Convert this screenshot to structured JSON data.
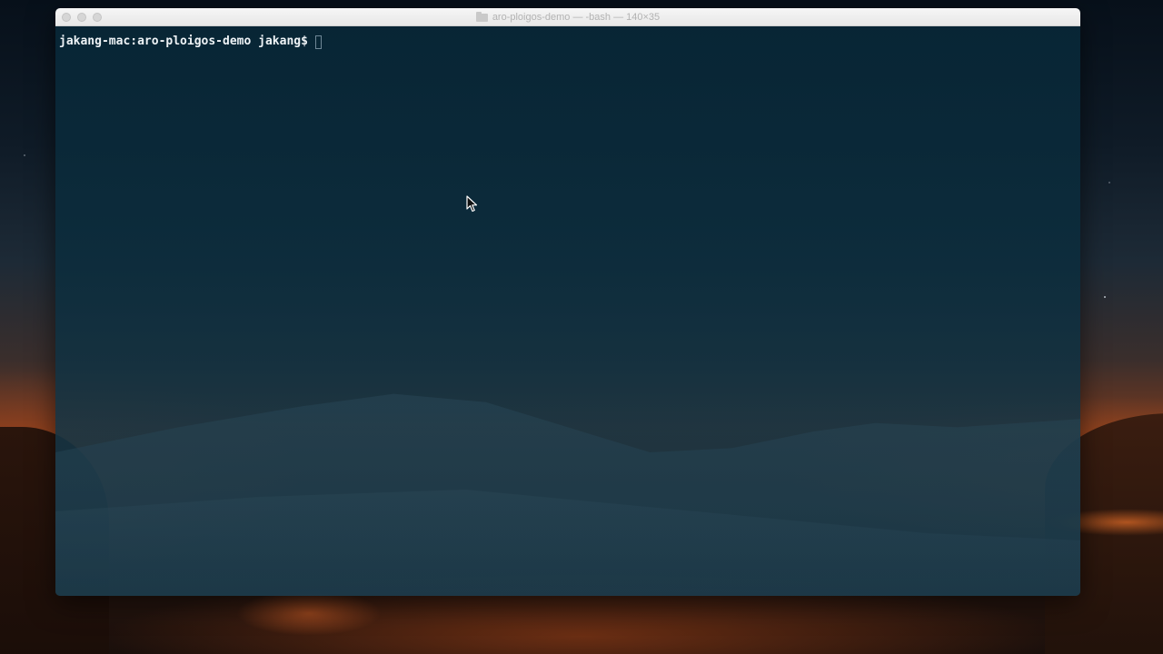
{
  "window": {
    "title": "aro-ploigos-demo — -bash — 140×35",
    "icon": "folder-icon"
  },
  "terminal": {
    "prompt": "jakang-mac:aro-ploigos-demo jakang$",
    "input": ""
  },
  "colors": {
    "terminal_bg": "#0c2c3c",
    "terminal_text": "#eef3f6",
    "titlebar_bg": "#ececec",
    "desktop_glow": "#d65c1e"
  }
}
